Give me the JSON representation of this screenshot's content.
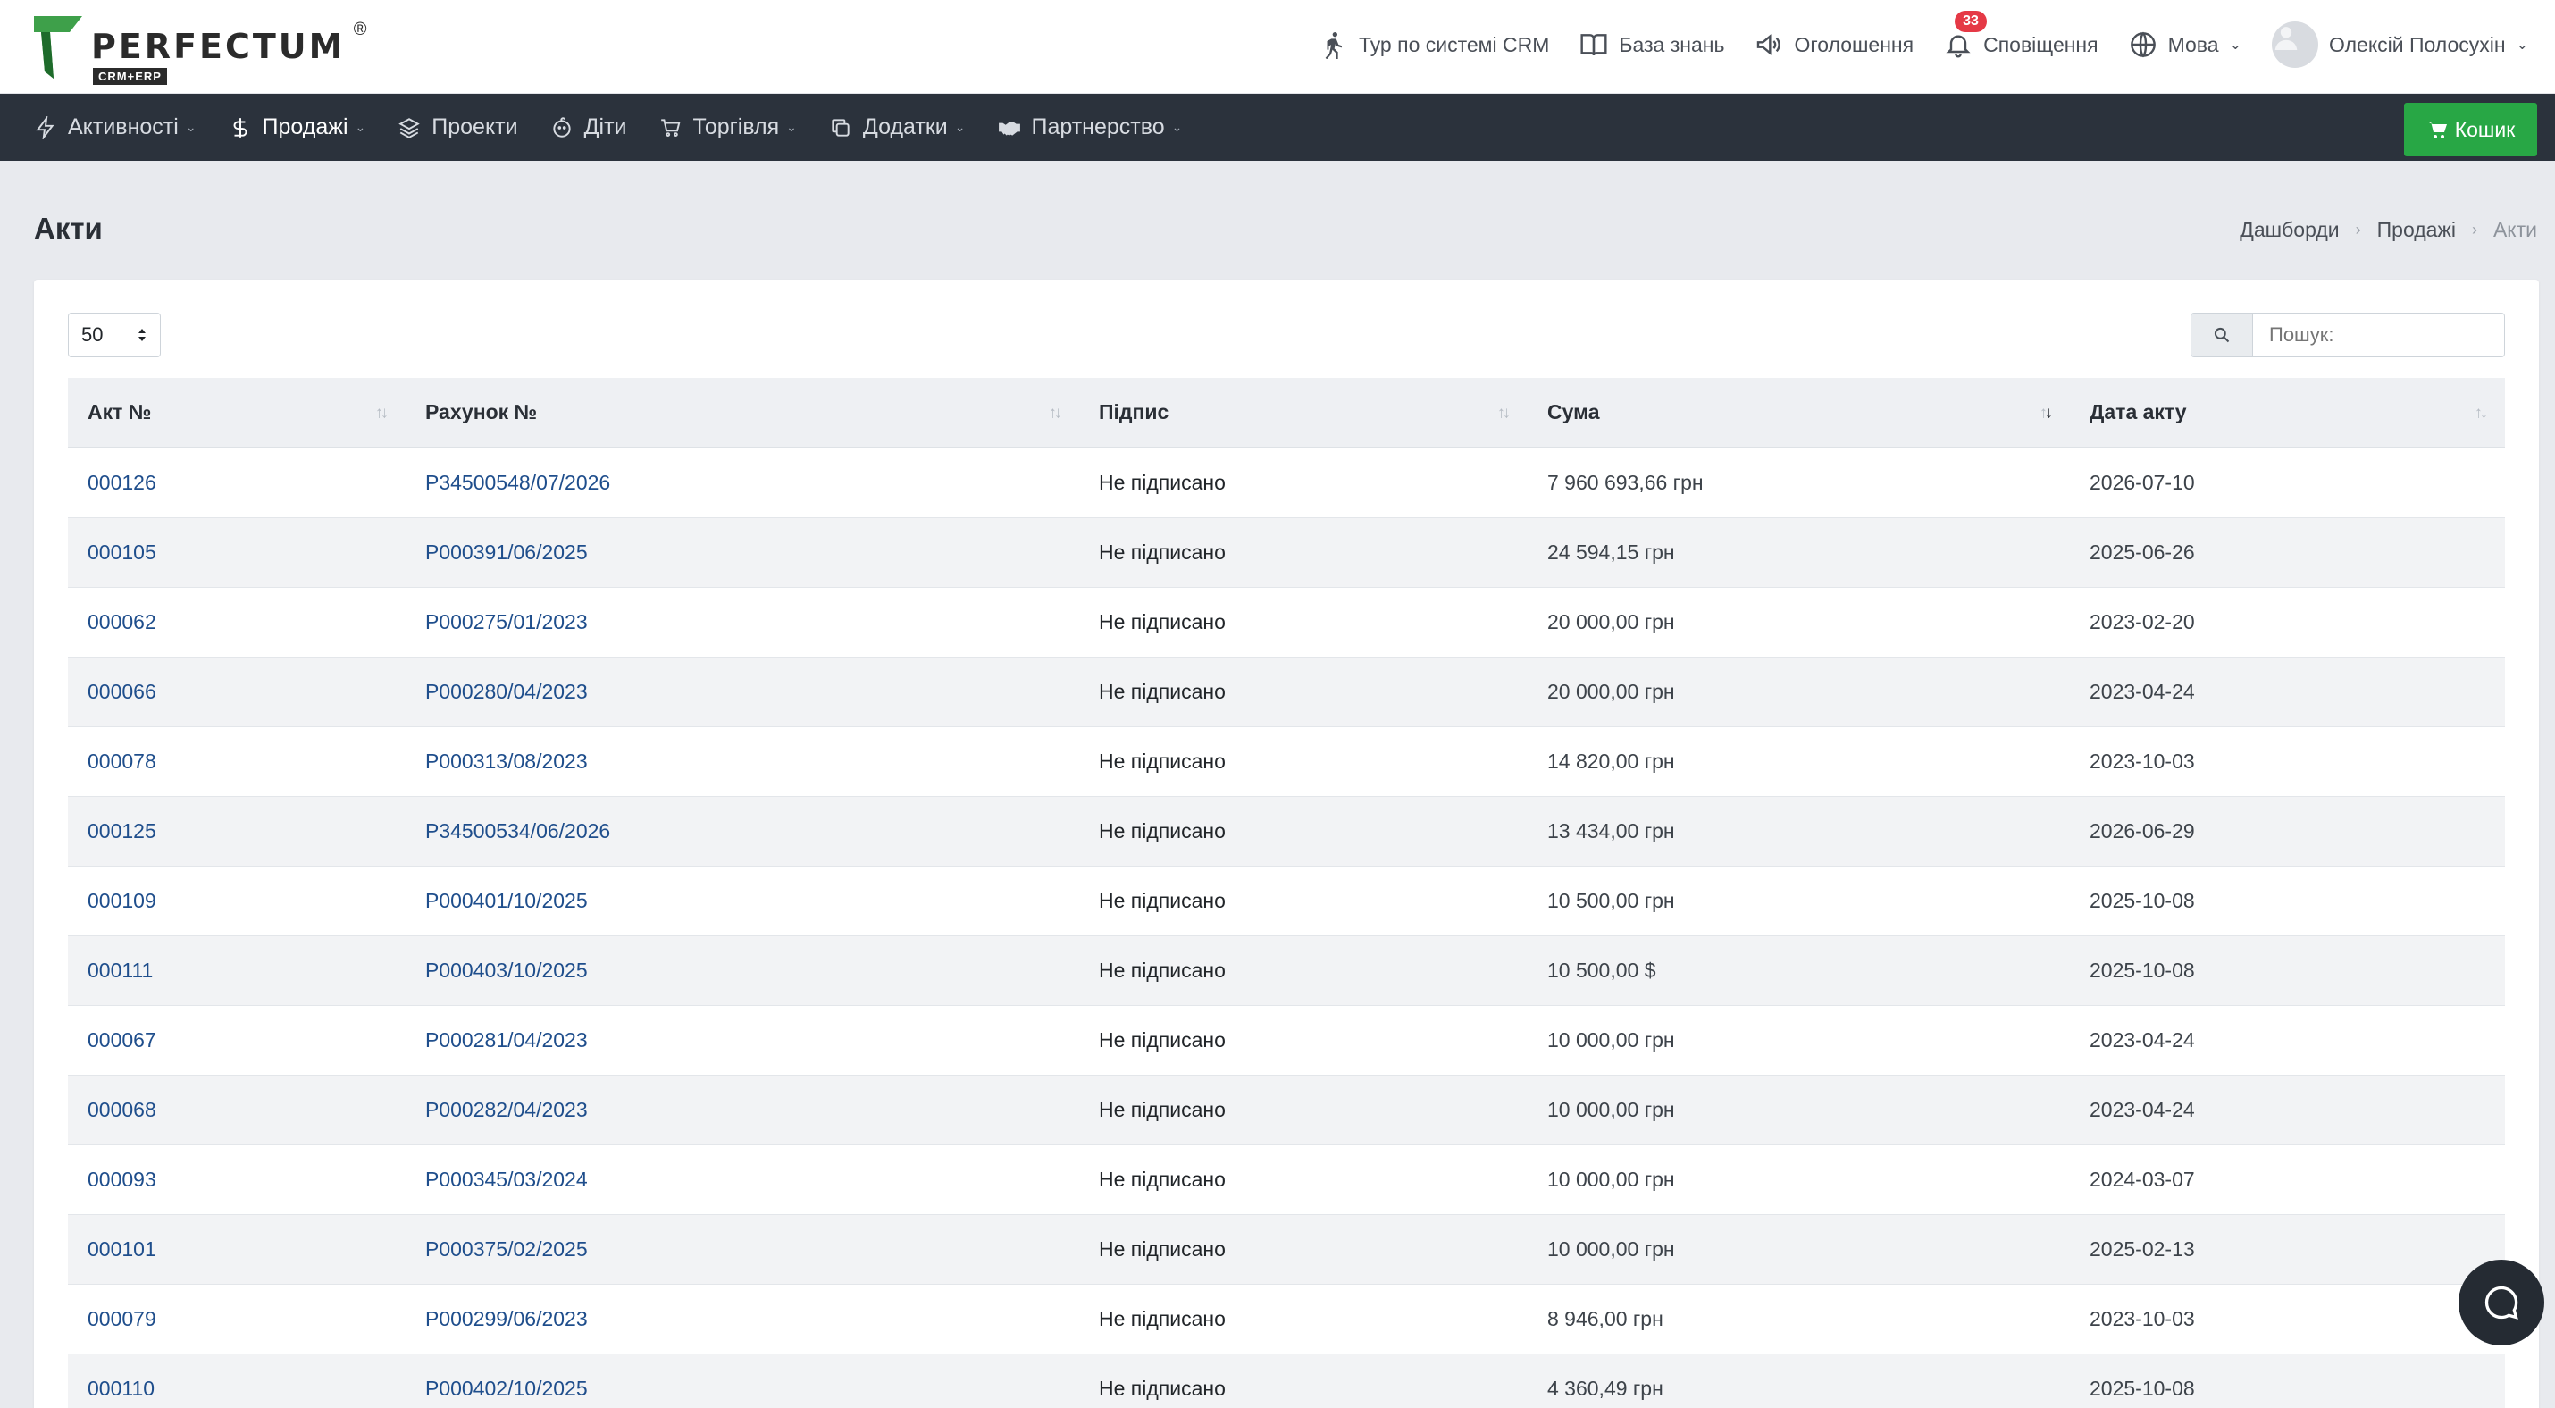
{
  "brand": {
    "name": "PERFECTUM",
    "sub": "CRM+ERP",
    "reg": "®"
  },
  "header": {
    "tour": "Тур по системі CRM",
    "kb": "База знань",
    "announcements": "Оголошення",
    "notifications": "Сповіщення",
    "notifications_count": "33",
    "language": "Мова",
    "user": "Олексій Полосухін"
  },
  "nav": {
    "items": [
      {
        "label": "Активності",
        "icon": "lightning-icon",
        "caret": true
      },
      {
        "label": "Продажі",
        "icon": "dollar-icon",
        "caret": true,
        "active": true
      },
      {
        "label": "Проекти",
        "icon": "layers-icon",
        "caret": false
      },
      {
        "label": "Діти",
        "icon": "baby-icon",
        "caret": false
      },
      {
        "label": "Торгівля",
        "icon": "cart-icon",
        "caret": true
      },
      {
        "label": "Додатки",
        "icon": "copy-icon",
        "caret": true
      },
      {
        "label": "Партнерство",
        "icon": "handshake-icon",
        "caret": true
      }
    ],
    "cart": "Кошик"
  },
  "page": {
    "title": "Акти",
    "breadcrumb": [
      "Дашборди",
      "Продажі",
      "Акти"
    ]
  },
  "table": {
    "page_size": "50",
    "search_placeholder": "Пошук:",
    "columns": [
      "Акт №",
      "Рахунок №",
      "Підпис",
      "Сума",
      "Дата акту"
    ],
    "rows": [
      [
        "000126",
        "P34500548/07/2026",
        "Не підписано",
        "7 960 693,66 грн",
        "2026-07-10"
      ],
      [
        "000105",
        "P000391/06/2025",
        "Не підписано",
        "24 594,15 грн",
        "2025-06-26"
      ],
      [
        "000062",
        "P000275/01/2023",
        "Не підписано",
        "20 000,00 грн",
        "2023-02-20"
      ],
      [
        "000066",
        "P000280/04/2023",
        "Не підписано",
        "20 000,00 грн",
        "2023-04-24"
      ],
      [
        "000078",
        "P000313/08/2023",
        "Не підписано",
        "14 820,00 грн",
        "2023-10-03"
      ],
      [
        "000125",
        "P34500534/06/2026",
        "Не підписано",
        "13 434,00 грн",
        "2026-06-29"
      ],
      [
        "000109",
        "P000401/10/2025",
        "Не підписано",
        "10 500,00 грн",
        "2025-10-08"
      ],
      [
        "000111",
        "P000403/10/2025",
        "Не підписано",
        "10 500,00 $",
        "2025-10-08"
      ],
      [
        "000067",
        "P000281/04/2023",
        "Не підписано",
        "10 000,00 грн",
        "2023-04-24"
      ],
      [
        "000068",
        "P000282/04/2023",
        "Не підписано",
        "10 000,00 грн",
        "2023-04-24"
      ],
      [
        "000093",
        "P000345/03/2024",
        "Не підписано",
        "10 000,00 грн",
        "2024-03-07"
      ],
      [
        "000101",
        "P000375/02/2025",
        "Не підписано",
        "10 000,00 грн",
        "2025-02-13"
      ],
      [
        "000079",
        "P000299/06/2023",
        "Не підписано",
        "8 946,00 грн",
        "2023-10-03"
      ],
      [
        "000110",
        "P000402/10/2025",
        "Не підписано",
        "4 360,49 грн",
        "2025-10-08"
      ]
    ]
  },
  "colors": {
    "nav_bg": "#2b323c",
    "cart_bg": "#28a745",
    "link": "#1f4e8c",
    "badge": "#e53946",
    "logo_green": "#3ea04a"
  }
}
